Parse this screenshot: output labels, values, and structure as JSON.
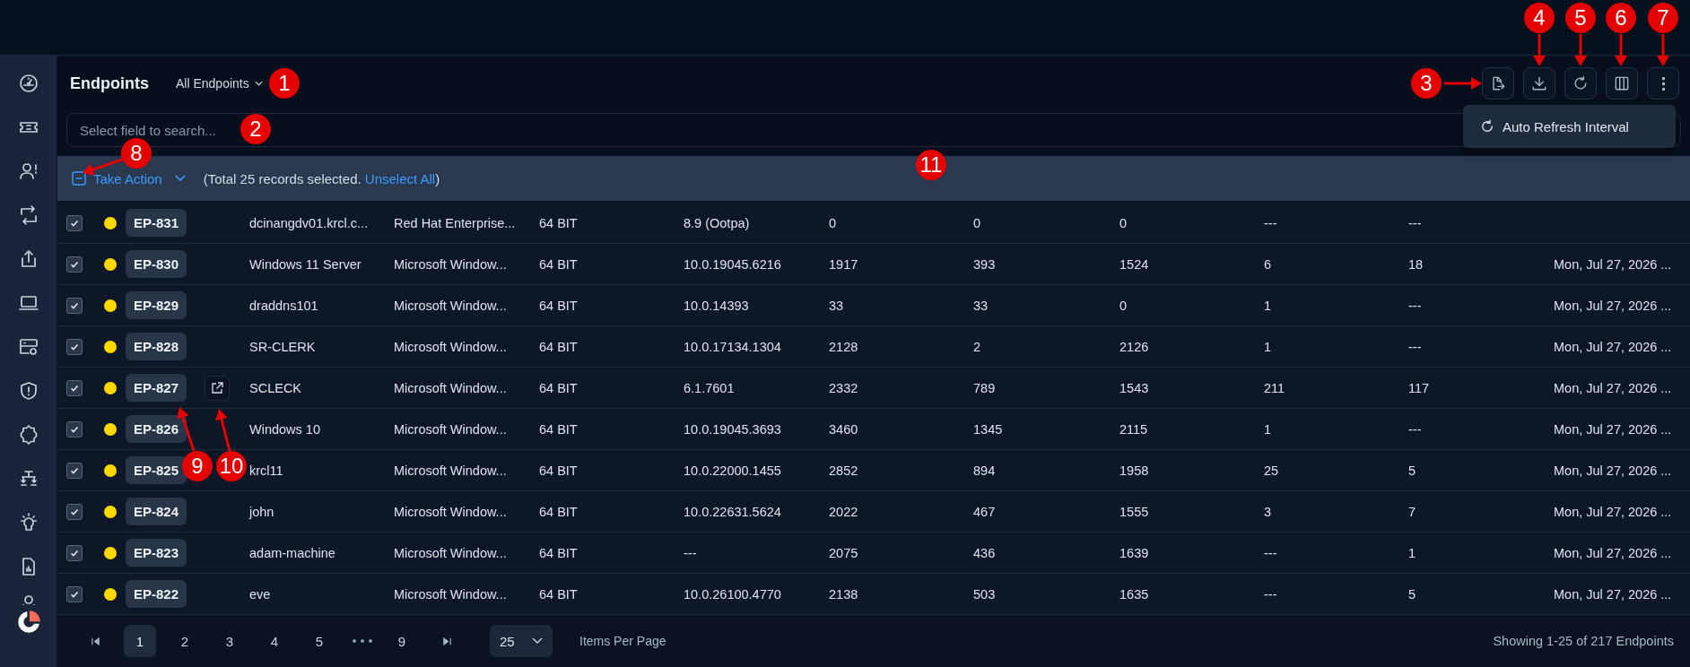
{
  "page": {
    "title": "Endpoints",
    "view_selector": "All Endpoints"
  },
  "toolbar": [
    {
      "kind": "export"
    },
    {
      "kind": "download"
    },
    {
      "kind": "refresh"
    },
    {
      "kind": "columns"
    },
    {
      "kind": "more"
    }
  ],
  "menu": {
    "items": [
      {
        "label": "Auto Refresh Interval"
      }
    ]
  },
  "search": {
    "placeholder": "Select field to search..."
  },
  "action_bar": {
    "indeterminate": true,
    "action": "Take Action",
    "summary_before": "(Total 25 records selected.",
    "link": "Unselect All",
    "summary_after": ")"
  },
  "rows": [
    {
      "id": "EP-831",
      "selected": true,
      "hovered": false,
      "cells": [
        "dcinangdv01.krcl.c...",
        "Red Hat Enterprise...",
        "64 BIT",
        "8.9 (Ootpa)",
        "0",
        "0",
        "0",
        "---",
        "---"
      ]
    },
    {
      "id": "EP-830",
      "selected": true,
      "hovered": false,
      "cells": [
        "Windows 11 Server",
        "Microsoft Window...",
        "64 BIT",
        "10.0.19045.6216",
        "1917",
        "393",
        "1524",
        "6",
        "18",
        "Mon, Jul 27, 2026 ..."
      ]
    },
    {
      "id": "EP-829",
      "selected": true,
      "hovered": false,
      "cells": [
        "draddns101",
        "Microsoft Window...",
        "64 BIT",
        "10.0.14393",
        "33",
        "33",
        "0",
        "1",
        "---",
        "Mon, Jul 27, 2026 ..."
      ]
    },
    {
      "id": "EP-828",
      "selected": true,
      "hovered": false,
      "cells": [
        "SR-CLERK",
        "Microsoft Window...",
        "64 BIT",
        "10.0.17134.1304",
        "2128",
        "2",
        "2126",
        "1",
        "---",
        "Mon, Jul 27, 2026 ..."
      ]
    },
    {
      "id": "EP-827",
      "selected": true,
      "hovered": true,
      "cells": [
        "SCLECK",
        "Microsoft Window...",
        "64 BIT",
        "6.1.7601",
        "2332",
        "789",
        "1543",
        "211",
        "117",
        "Mon, Jul 27, 2026 ..."
      ]
    },
    {
      "id": "EP-826",
      "selected": true,
      "hovered": false,
      "cells": [
        "Windows 10",
        "Microsoft Window...",
        "64 BIT",
        "10.0.19045.3693",
        "3460",
        "1345",
        "2115",
        "1",
        "---",
        "Mon, Jul 27, 2026 ..."
      ]
    },
    {
      "id": "EP-825",
      "selected": true,
      "hovered": false,
      "cells": [
        "krcl11",
        "Microsoft Window...",
        "64 BIT",
        "10.0.22000.1455",
        "2852",
        "894",
        "1958",
        "25",
        "5",
        "Mon, Jul 27, 2026 ..."
      ]
    },
    {
      "id": "EP-824",
      "selected": true,
      "hovered": false,
      "cells": [
        "john",
        "Microsoft Window...",
        "64 BIT",
        "10.0.22631.5624",
        "2022",
        "467",
        "1555",
        "3",
        "7",
        "Mon, Jul 27, 2026 ..."
      ]
    },
    {
      "id": "EP-823",
      "selected": true,
      "hovered": false,
      "cells": [
        "adam-machine",
        "Microsoft Window...",
        "64 BIT",
        "---",
        "2075",
        "436",
        "1639",
        "---",
        "1",
        "Mon, Jul 27, 2026 ..."
      ]
    },
    {
      "id": "EP-822",
      "selected": true,
      "hovered": false,
      "cells": [
        "eve",
        "Microsoft Window...",
        "64 BIT",
        "10.0.26100.4770",
        "2138",
        "503",
        "1635",
        "---",
        "5",
        "Mon, Jul 27, 2026 ..."
      ]
    }
  ],
  "pagination": {
    "pages": [
      {
        "label": "1",
        "selected": true
      },
      {
        "label": "2",
        "selected": false
      },
      {
        "label": "3",
        "selected": false
      },
      {
        "label": "4",
        "selected": false
      },
      {
        "label": "5",
        "selected": false
      },
      {
        "label": "9",
        "selected": false
      }
    ],
    "page_size": "25",
    "page_size_label": "Items Per Page",
    "summary": "Showing 1-25 of 217 Endpoints"
  },
  "annotations": [
    {
      "number": "1"
    },
    {
      "number": "2"
    },
    {
      "number": "3"
    },
    {
      "number": "4"
    },
    {
      "number": "5"
    },
    {
      "number": "6"
    },
    {
      "number": "7"
    },
    {
      "number": "8"
    },
    {
      "number": "9"
    },
    {
      "number": "10"
    },
    {
      "number": "11"
    }
  ]
}
